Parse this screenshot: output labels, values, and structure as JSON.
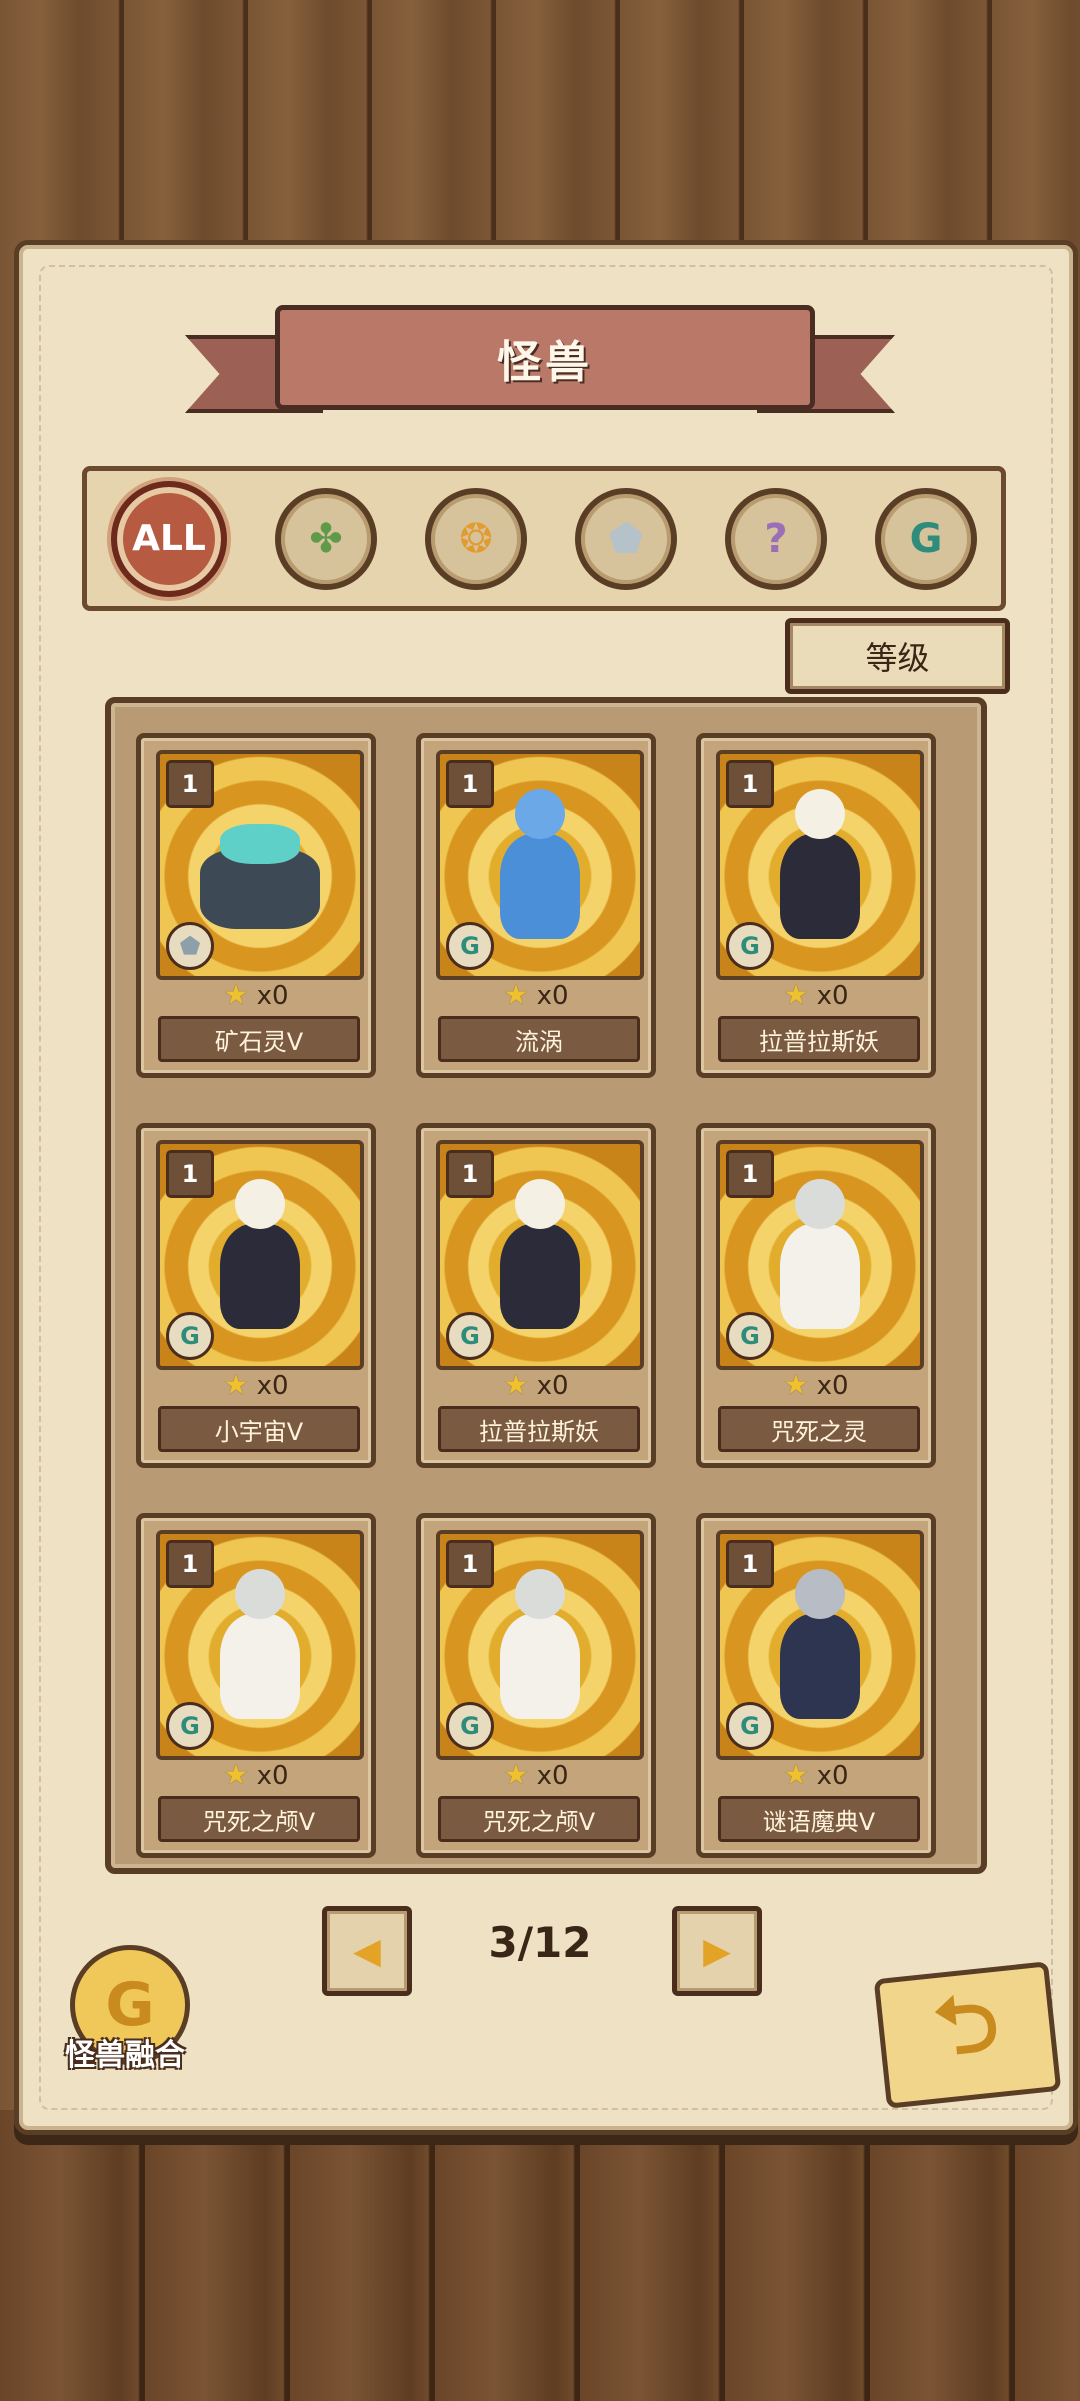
{
  "title": "怪兽",
  "filters": [
    {
      "label": "ALL",
      "icon": "all-icon",
      "active": true
    },
    {
      "label": "",
      "icon": "leaf-icon",
      "active": false
    },
    {
      "label": "",
      "icon": "paw-icon",
      "active": false
    },
    {
      "label": "",
      "icon": "crystal-icon",
      "active": false
    },
    {
      "label": "",
      "icon": "question-icon",
      "active": false
    },
    {
      "label": "",
      "icon": "rune-g-icon",
      "active": false
    }
  ],
  "sort_label": "等级",
  "cards": [
    {
      "level": "1",
      "stars": "x0",
      "name": "矿石灵V",
      "type_icon": "crystal-icon"
    },
    {
      "level": "1",
      "stars": "x0",
      "name": "流涡",
      "type_icon": "rune-g-icon"
    },
    {
      "level": "1",
      "stars": "x0",
      "name": "拉普拉斯妖",
      "type_icon": "rune-g-icon"
    },
    {
      "level": "1",
      "stars": "x0",
      "name": "小宇宙V",
      "type_icon": "rune-g-icon"
    },
    {
      "level": "1",
      "stars": "x0",
      "name": "拉普拉斯妖",
      "type_icon": "rune-g-icon"
    },
    {
      "level": "1",
      "stars": "x0",
      "name": "咒死之灵",
      "type_icon": "rune-g-icon"
    },
    {
      "level": "1",
      "stars": "x0",
      "name": "咒死之颅V",
      "type_icon": "rune-g-icon"
    },
    {
      "level": "1",
      "stars": "x0",
      "name": "咒死之颅V",
      "type_icon": "rune-g-icon"
    },
    {
      "level": "1",
      "stars": "x0",
      "name": "谜语魔典V",
      "type_icon": "rune-g-icon"
    }
  ],
  "pagination": {
    "text": "3/12"
  },
  "fusion_label": "怪兽融合",
  "colors": {
    "ribbon": "#b97868",
    "parchment": "#efe2c4",
    "card_art": "#e2ad2d"
  }
}
